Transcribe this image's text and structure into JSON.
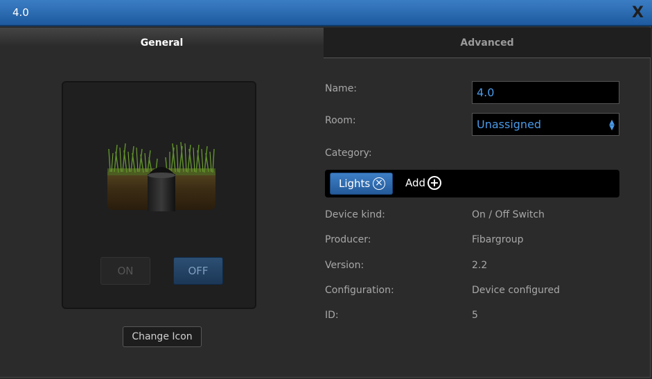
{
  "window": {
    "title": "4.0",
    "close_label": "X"
  },
  "tabs": {
    "general": "General",
    "advanced": "Advanced"
  },
  "icon_panel": {
    "on_label": "ON",
    "off_label": "OFF",
    "change_icon_label": "Change Icon",
    "state": "off"
  },
  "form": {
    "name_label": "Name:",
    "name_value": "4.0",
    "room_label": "Room:",
    "room_value": "Unassigned",
    "category_label": "Category:",
    "category_chip": "Lights",
    "add_label": "Add"
  },
  "info": {
    "device_kind_label": "Device kind:",
    "device_kind_value": "On / Off Switch",
    "producer_label": "Producer:",
    "producer_value": "Fibargroup",
    "version_label": "Version:",
    "version_value": "2.2",
    "configuration_label": "Configuration:",
    "configuration_value": "Device configured",
    "id_label": "ID:",
    "id_value": "5"
  },
  "icons": {
    "close": "close-icon",
    "remove": "remove-circle-icon",
    "add": "add-circle-icon",
    "device": "garden-light-device-icon",
    "select": "select-arrows-icon"
  },
  "colors": {
    "titlebar": "#2f6fb5",
    "accent": "#4a9ae8",
    "chip": "#3574bd"
  }
}
